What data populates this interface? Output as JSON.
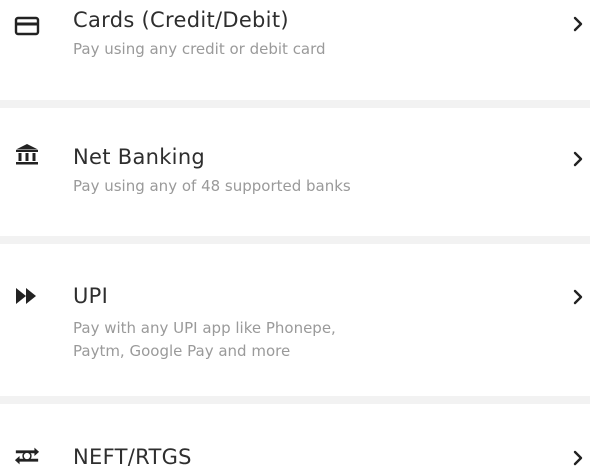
{
  "payment_options": [
    {
      "icon": "card-icon",
      "title": "Cards (Credit/Debit)",
      "description": "Pay using any credit or debit card"
    },
    {
      "icon": "bank-icon",
      "title": "Net Banking",
      "description": "Pay using any of 48 supported banks"
    },
    {
      "icon": "double-chevron-right-icon",
      "title": "UPI",
      "description_lines": [
        "Pay with any UPI app like Phonepe,",
        "Paytm, Google Pay and more"
      ]
    },
    {
      "icon": "transfer-icon",
      "title": "NEFT/RTGS"
    }
  ],
  "colors": {
    "title_text": "#2e2e2e",
    "description_text": "#9a9a9a",
    "icon": "#222222",
    "divider": "#f2f2f2"
  }
}
